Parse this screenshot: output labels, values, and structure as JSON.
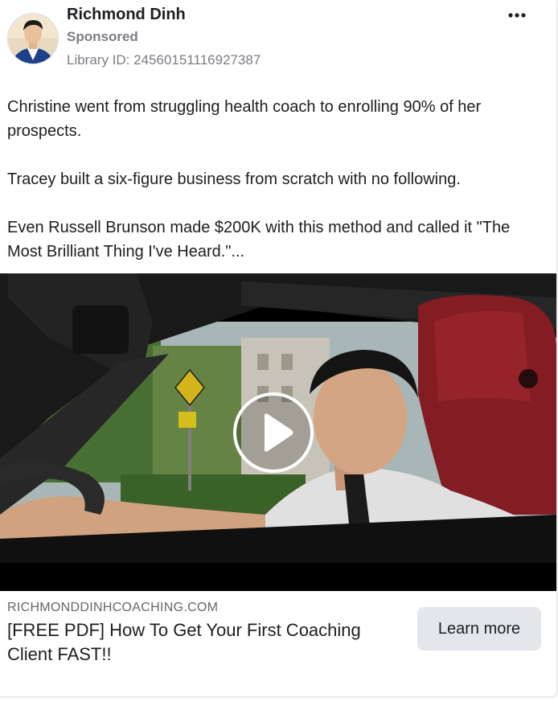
{
  "post": {
    "author": "Richmond Dinh",
    "sponsored_label": "Sponsored",
    "library_id": "Library ID: 24560151116927387",
    "more_icon": "three-dots-icon",
    "body_paragraphs": [
      "Christine went from struggling health coach to enrolling 90% of her prospects.",
      "Tracey built a six-figure business from scratch with no following.",
      "Even Russell Brunson made $200K with this method and called it \"The Most Brilliant Thing I've Heard.\"..."
    ]
  },
  "media": {
    "type": "video",
    "play_icon": "play-icon"
  },
  "link": {
    "domain": "RICHMONDDINHCOACHING.COM",
    "headline": "[FREE PDF] How To Get Your First Coaching Client FAST!!",
    "cta_label": "Learn more"
  },
  "colors": {
    "text_primary": "#1c1e21",
    "text_secondary": "#65676b",
    "button_bg": "#e4e6eb"
  }
}
